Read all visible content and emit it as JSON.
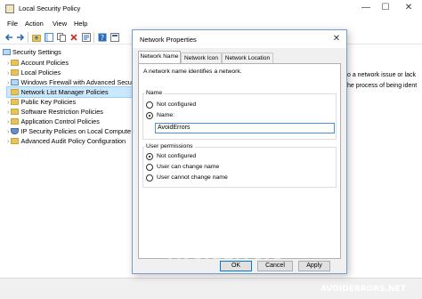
{
  "window": {
    "title": "Local Security Policy",
    "controls": {
      "minimize": "—",
      "maximize": "☐",
      "close": "✕"
    }
  },
  "menu": [
    "File",
    "Action",
    "View",
    "Help"
  ],
  "tree": {
    "items": [
      "Security Settings",
      "Account Policies",
      "Local Policies",
      "Windows Firewall with Advanced Secu",
      "Network List Manager Policies",
      "Public Key Policies",
      "Software Restriction Policies",
      "Application Control Policies",
      "IP Security Policies on Local Compute",
      "Advanced Audit Policy Configuration"
    ]
  },
  "right_pane": {
    "line1": "o a network issue or lack",
    "line2": "he process of being ident"
  },
  "dialog": {
    "title": "Network Properties",
    "close": "✕",
    "tabs": [
      "Network Name",
      "Network Icon",
      "Network Location"
    ],
    "intro": "A network name identifies a network.",
    "name_group": {
      "label": "Name",
      "options": [
        "Not configured",
        "Name:"
      ],
      "selected": 1,
      "value": "AvoidErrors"
    },
    "perm_group": {
      "label": "User permissions",
      "options": [
        "Not configured",
        "User can change name",
        "User cannot change name"
      ],
      "selected": 0
    },
    "buttons": {
      "ok": "OK",
      "cancel": "Cancel",
      "apply": "Apply"
    }
  },
  "watermark": {
    "text": "AvoidErrors",
    "url": "AVOIDERRORS.NET"
  }
}
